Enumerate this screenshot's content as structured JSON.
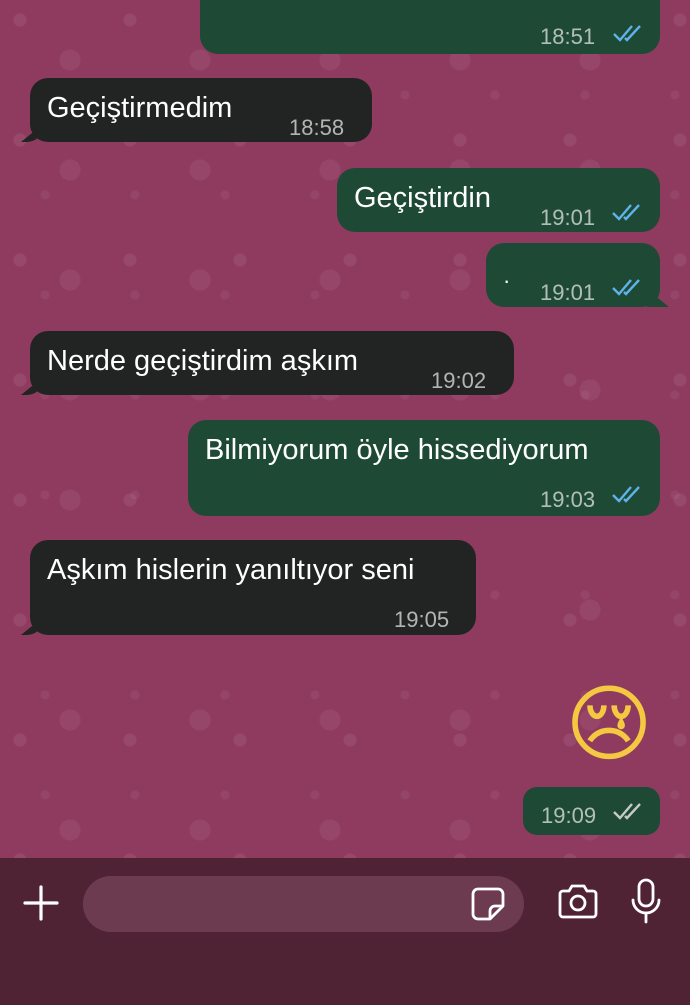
{
  "messages": [
    {
      "text": "",
      "time": "18:51",
      "ticks": "read"
    },
    {
      "text": "Geçiştirmedim",
      "time": "18:58"
    },
    {
      "text": "Geçiştirdin",
      "time": "19:01",
      "ticks": "read"
    },
    {
      "text": "·",
      "time": "19:01",
      "ticks": "read"
    },
    {
      "text": "Nerde geçiştirdim aşkım",
      "time": "19:02"
    },
    {
      "text": "Bilmiyorum öyle hissediyorum",
      "time": "19:03",
      "ticks": "read"
    },
    {
      "text": "Aşkım hislerin yanıltıyor seni",
      "time": "19:05"
    },
    {
      "text": "😢",
      "time": "19:09",
      "ticks": "delivered"
    }
  ],
  "colors": {
    "chat_background": "#8f3b60",
    "incoming_bubble": "#222424",
    "outgoing_bubble": "#1e4a35",
    "read_ticks": "#5fb3ea",
    "delivered_ticks": "#c9c9c9",
    "input_bar": "#4f2234"
  },
  "input_bar": {
    "icons": [
      "plus-icon",
      "sticker-icon",
      "camera-icon",
      "microphone-icon"
    ]
  }
}
